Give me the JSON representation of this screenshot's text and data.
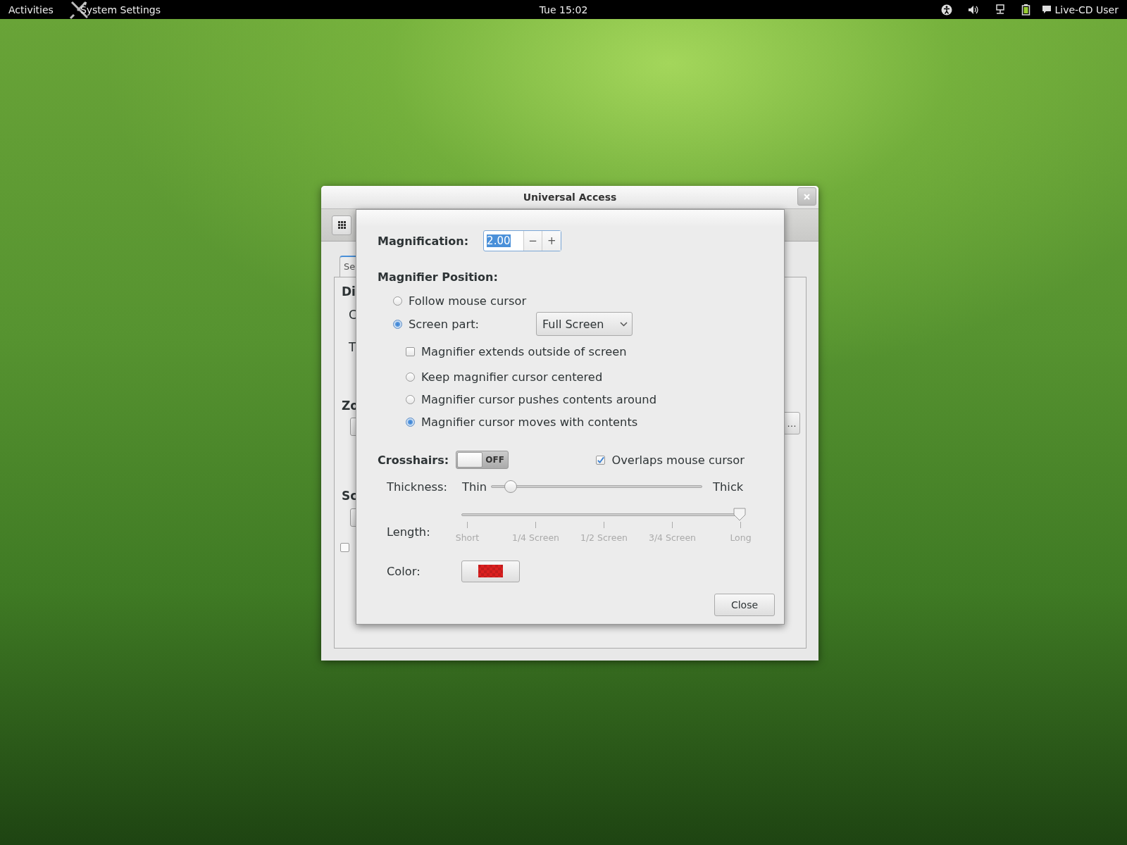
{
  "top_bar": {
    "activities": "Activities",
    "app_name": "System Settings",
    "clock": "Tue 15:02",
    "user": "Live-CD User"
  },
  "back_window": {
    "title": "Universal Access",
    "tab": {
      "label": "Se",
      "selected": true
    },
    "rows": [
      {
        "kind": "heading",
        "text": "Di"
      },
      {
        "kind": "label",
        "text": "C"
      },
      {
        "kind": "label",
        "text": "T"
      },
      {
        "kind": "heading",
        "text": "Zo"
      },
      {
        "kind": "control"
      },
      {
        "kind": "heading",
        "text": "Sc"
      },
      {
        "kind": "control"
      },
      {
        "kind": "checkbox",
        "checked": false
      }
    ],
    "more_button": "…"
  },
  "dialog": {
    "magnification": {
      "label": "Magnification:",
      "value": "2.00",
      "value_selected": true,
      "decrement": "−",
      "increment": "+"
    },
    "position": {
      "heading": "Magnifier Position:",
      "options": [
        {
          "label": "Follow mouse cursor",
          "selected": false
        },
        {
          "label": "Screen part:",
          "selected": true
        }
      ],
      "screen_part": "Full Screen",
      "extends_outside": {
        "label": "Magnifier extends outside of screen",
        "checked": false
      },
      "cursor_modes": [
        {
          "label": "Keep magnifier cursor centered",
          "selected": false
        },
        {
          "label": "Magnifier cursor pushes contents around",
          "selected": false
        },
        {
          "label": "Magnifier cursor moves with contents",
          "selected": true
        }
      ]
    },
    "crosshairs": {
      "label": "Crosshairs:",
      "on": false,
      "switch_text": "OFF",
      "overlaps": {
        "label": "Overlaps mouse cursor",
        "checked": true
      },
      "thickness": {
        "label": "Thickness:",
        "min_label": "Thin",
        "max_label": "Thick",
        "level": 0.07
      },
      "length": {
        "label": "Length:",
        "level": 1,
        "ticks": [
          "Short",
          "1/4 Screen",
          "1/2 Screen",
          "3/4 Screen",
          "Long"
        ]
      },
      "color": {
        "label": "Color:",
        "color": "#dd2020"
      }
    },
    "close": "Close"
  }
}
